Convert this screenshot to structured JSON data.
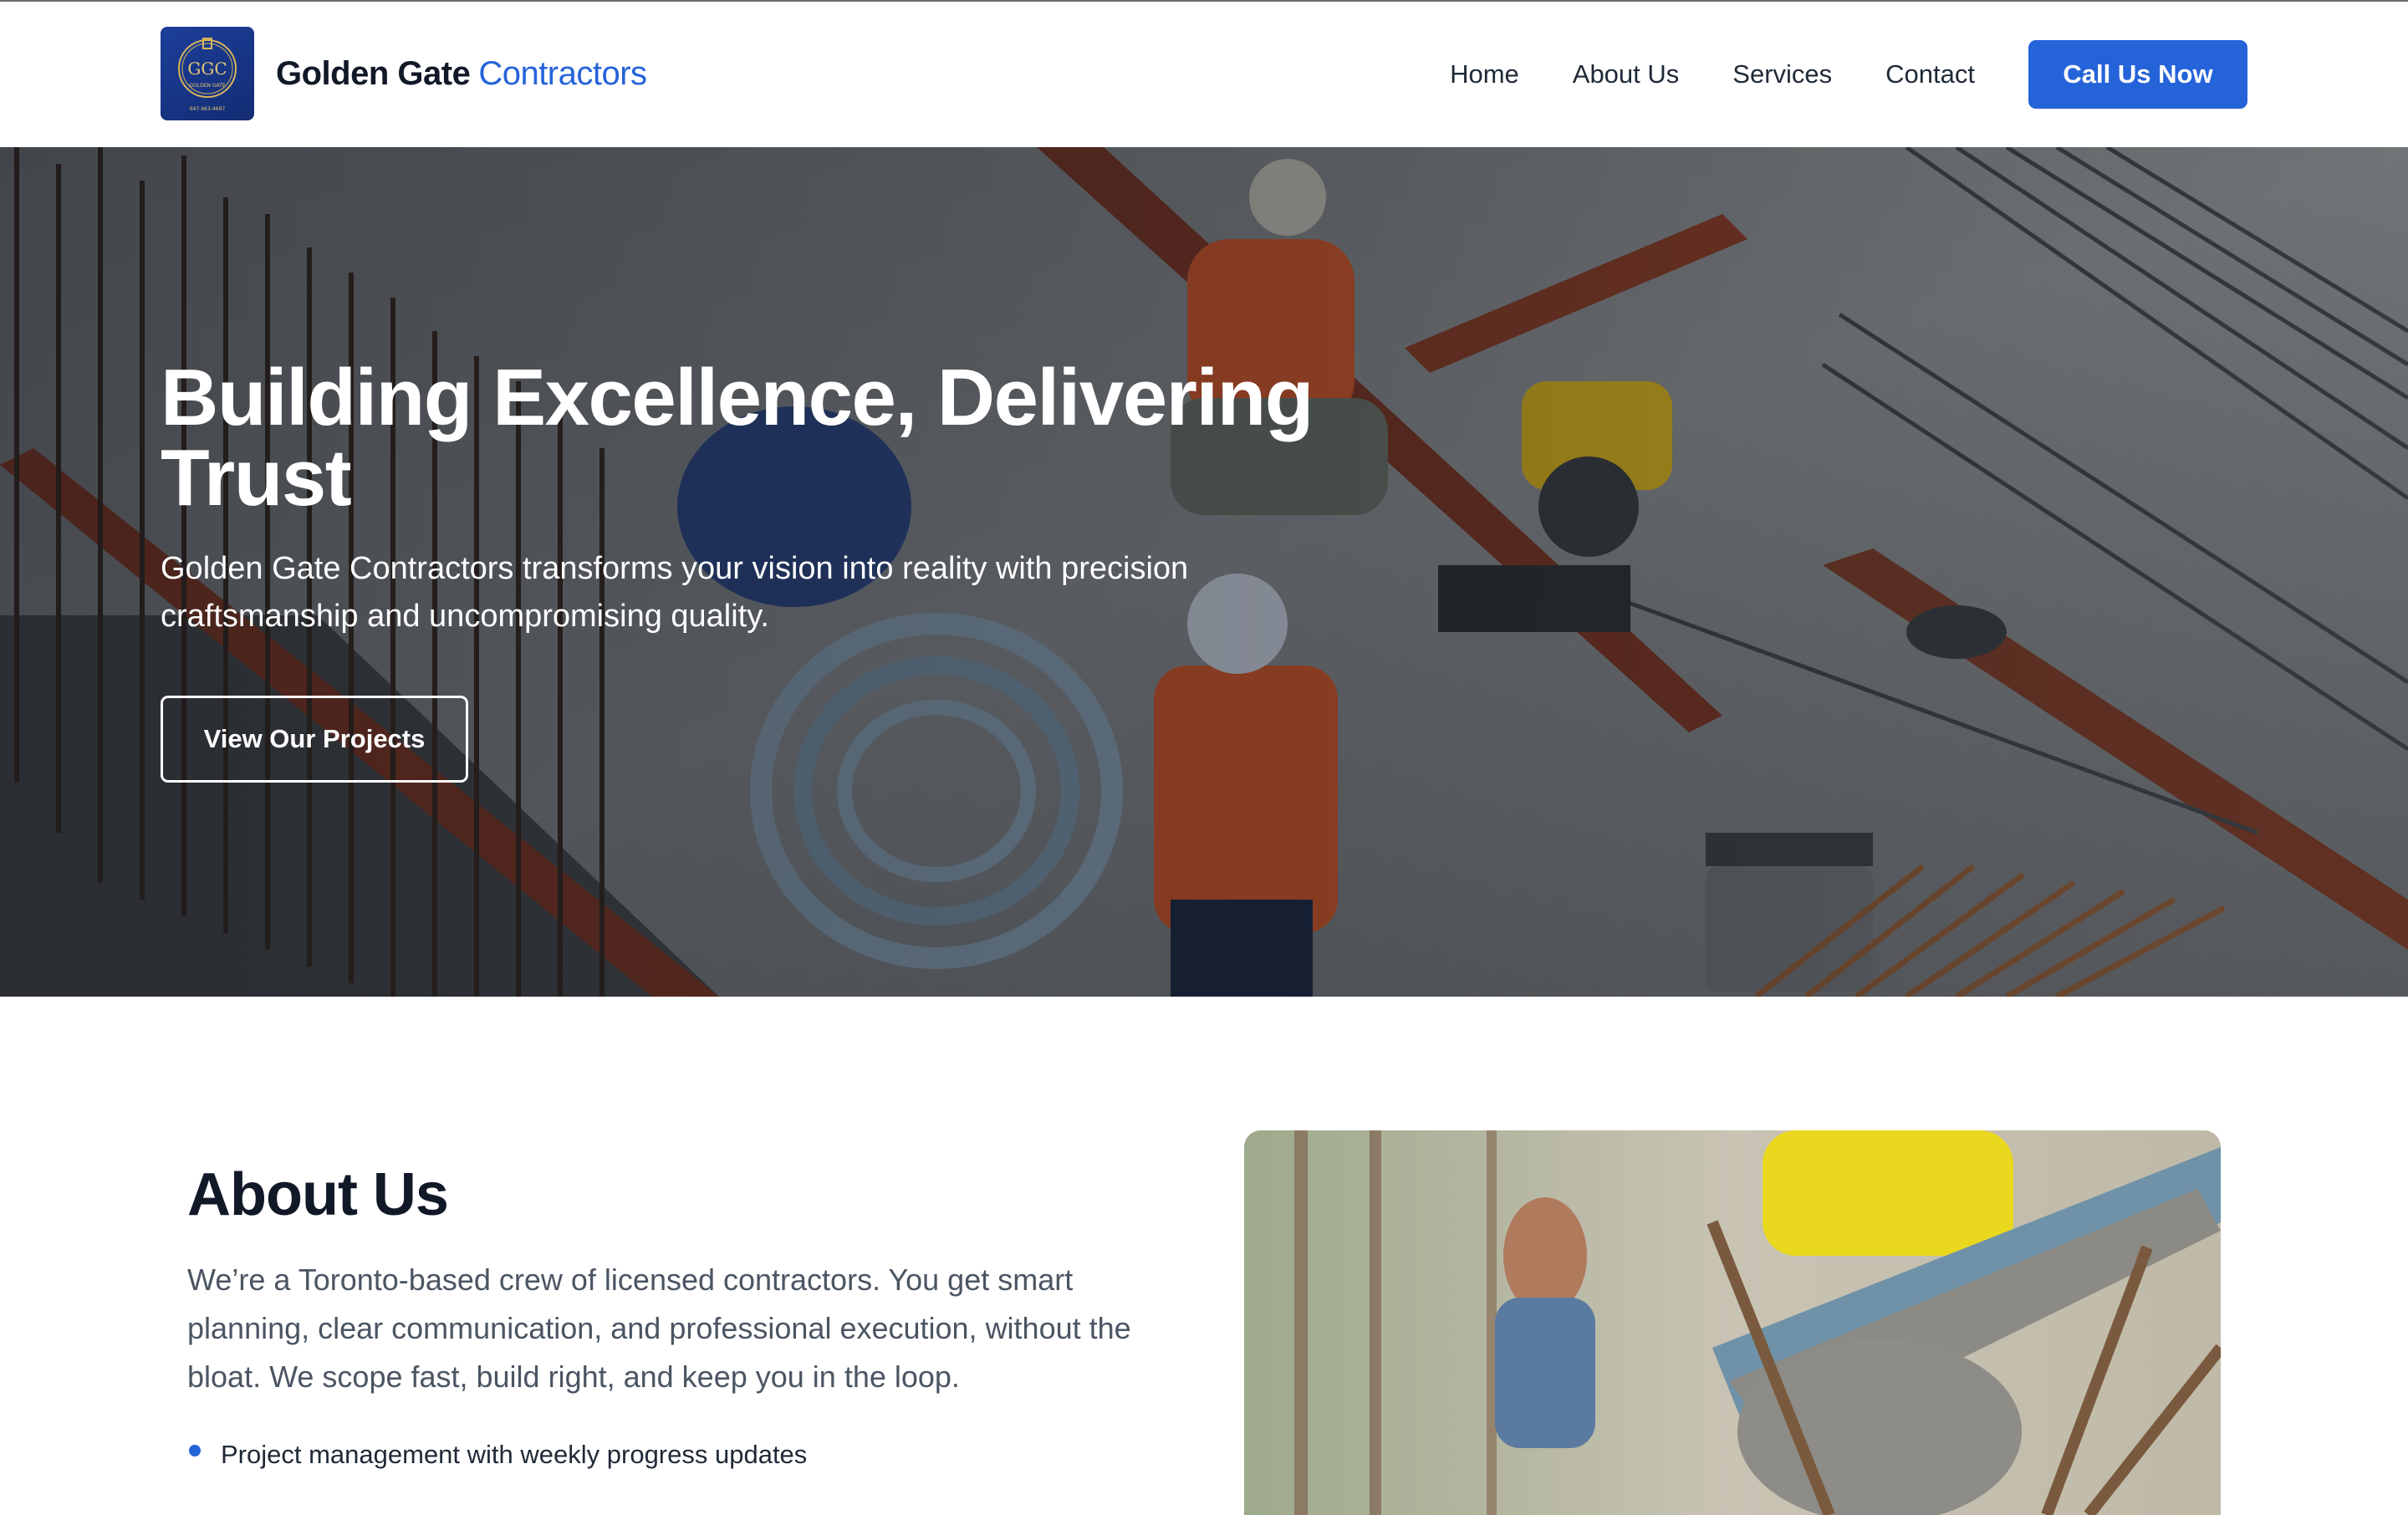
{
  "header": {
    "logo": {
      "icon": "ggc-logo-icon",
      "monogram": "GGC",
      "tagline": "GOLDEN GATE",
      "phone": "647-963-4697"
    },
    "brand_primary": "Golden Gate",
    "brand_accent": "Contractors",
    "nav": [
      "Home",
      "About Us",
      "Services",
      "Contact"
    ],
    "cta_label": "Call Us Now"
  },
  "hero": {
    "title": "Building Excellence, Delivering Trust",
    "subtitle": "Golden Gate Contractors transforms your vision into reality with precision craftsmanship and uncompromising quality.",
    "button_label": "View Our Projects",
    "image": "construction-site-workers-rebar-photo"
  },
  "about": {
    "title": "About Us",
    "text": "We’re a Toronto-based crew of licensed contractors. You get smart planning, clear communication, and professional execution, without the bloat. We scope fast, build right, and keep you in the loop.",
    "bullets": [
      "Project management with weekly progress updates"
    ],
    "image": "concrete-pouring-chute-photo"
  },
  "colors": {
    "accent": "#2563d9",
    "heading": "#111827",
    "body_text": "#4b5563",
    "logo_bg": "#1d3f9a"
  }
}
